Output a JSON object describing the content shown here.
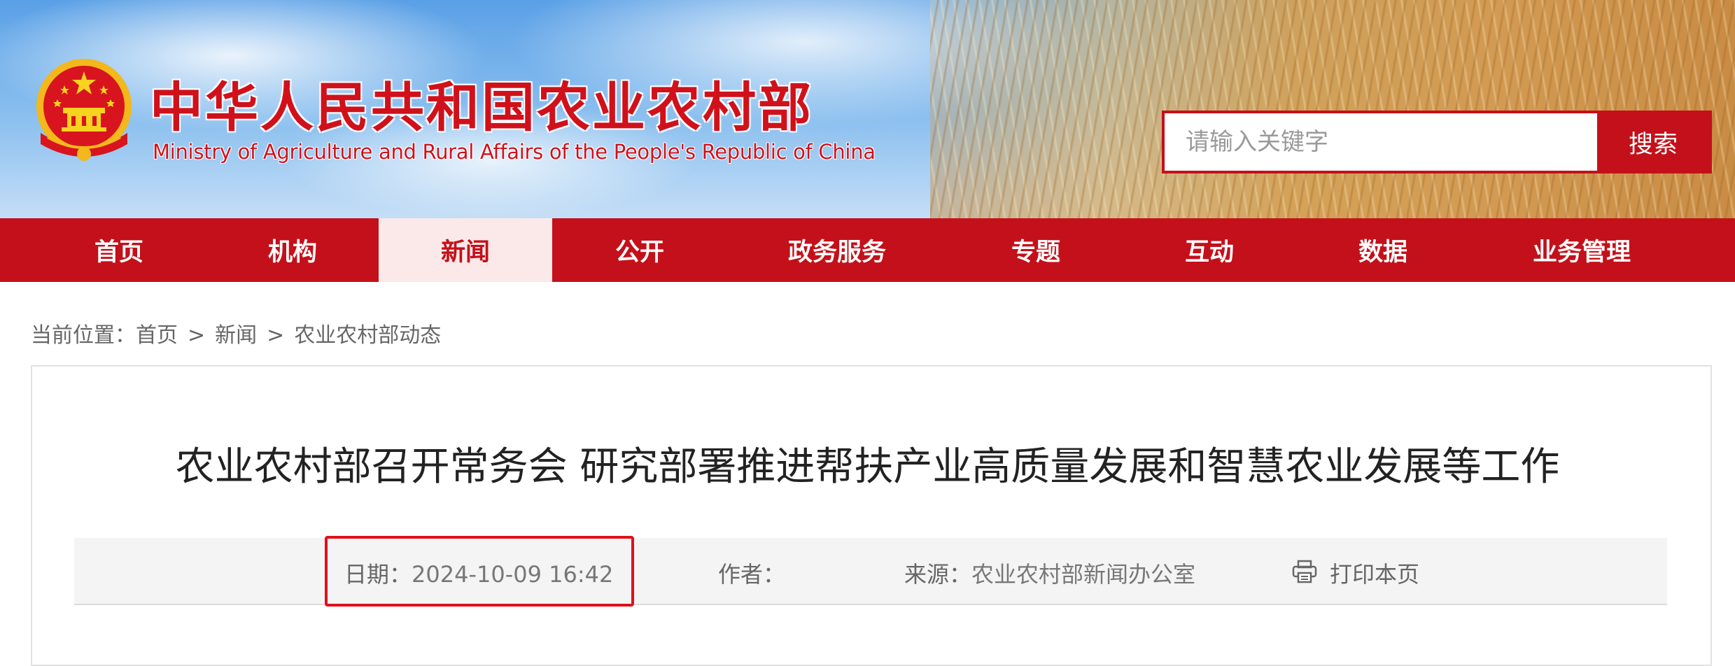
{
  "header": {
    "title_cn": "中华人民共和国农业农村部",
    "title_en": "Ministry of Agriculture and Rural Affairs of the People's Republic of China",
    "emblem_icon": "national-emblem-icon"
  },
  "search": {
    "placeholder": "请输入关键字",
    "button_label": "搜索"
  },
  "nav": {
    "items": [
      {
        "label": "首页"
      },
      {
        "label": "机构"
      },
      {
        "label": "新闻"
      },
      {
        "label": "公开"
      },
      {
        "label": "政务服务"
      },
      {
        "label": "专题"
      },
      {
        "label": "互动"
      },
      {
        "label": "数据"
      },
      {
        "label": "业务管理"
      }
    ],
    "active": "新闻"
  },
  "breadcrumb": {
    "prefix": "当前位置：",
    "items": [
      "首页",
      "新闻",
      "农业农村部动态"
    ],
    "separator": ">"
  },
  "article": {
    "title": "农业农村部召开常务会 研究部署推进帮扶产业高质量发展和智慧农业发展等工作",
    "meta": {
      "date_label": "日期：",
      "date_value": "2024-10-09 16:42",
      "author_label": "作者：",
      "author_value": "",
      "source_label": "来源：",
      "source_value": "农业农村部新闻办公室",
      "print_label": "打印本页",
      "print_icon": "printer-icon"
    }
  },
  "colors": {
    "brand_red": "#c4101a",
    "highlight_red": "#e0101a",
    "active_tab_bg": "#fbe9e9"
  }
}
